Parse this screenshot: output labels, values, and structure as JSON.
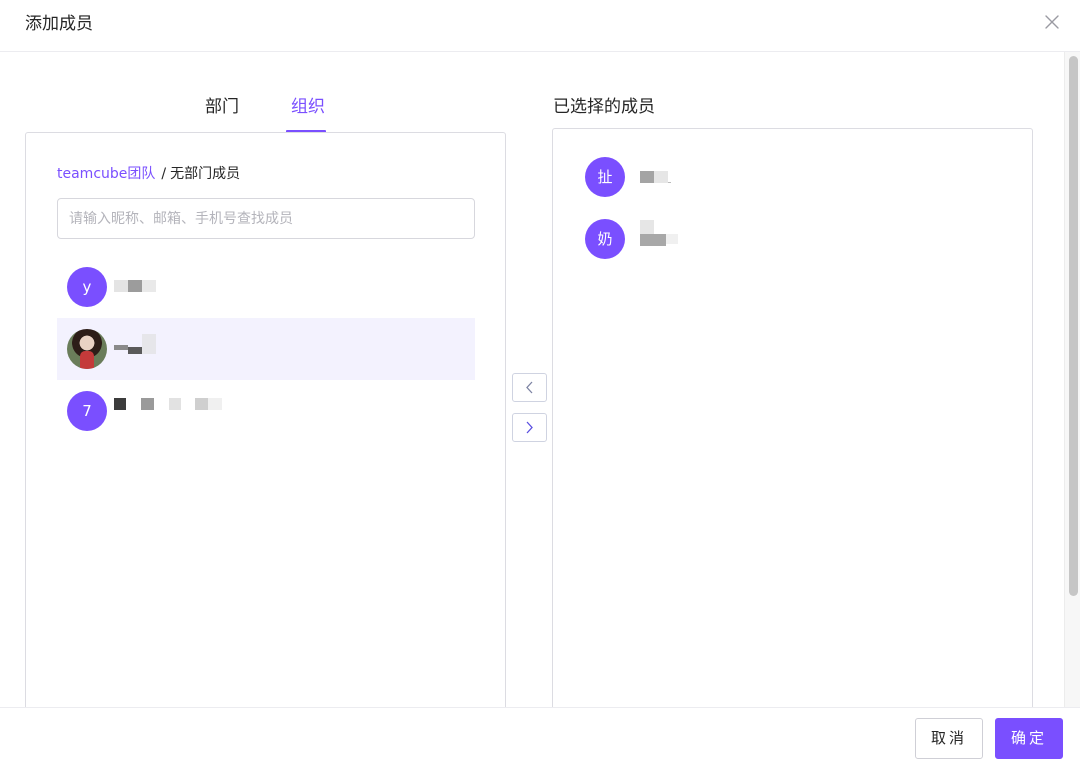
{
  "dialog": {
    "title": "添加成员",
    "close_icon": "close-icon"
  },
  "tabs": [
    {
      "label": "部门",
      "active": false
    },
    {
      "label": "组织",
      "active": true
    }
  ],
  "breadcrumb": {
    "root": "teamcube团队",
    "separator": "/",
    "current": "无部门成员"
  },
  "search": {
    "placeholder": "请输入昵称、邮箱、手机号查找成员",
    "value": ""
  },
  "members": [
    {
      "avatar_text": "y",
      "avatar_type": "letter",
      "selected": false
    },
    {
      "avatar_text": "",
      "avatar_type": "photo",
      "selected": true
    },
    {
      "avatar_text": "7",
      "avatar_type": "letter",
      "selected": false
    }
  ],
  "transfer": {
    "left_icon": "chevron-left-icon",
    "right_icon": "chevron-right-icon"
  },
  "selected_panel": {
    "title": "已选择的成员",
    "members": [
      {
        "avatar_text": "扯"
      },
      {
        "avatar_text": "奶"
      }
    ]
  },
  "footer": {
    "cancel_label": "取消",
    "ok_label": "确定"
  },
  "colors": {
    "accent": "#7a4fff",
    "selected_row_bg": "#f3f2fe",
    "border": "#dcdce2"
  }
}
